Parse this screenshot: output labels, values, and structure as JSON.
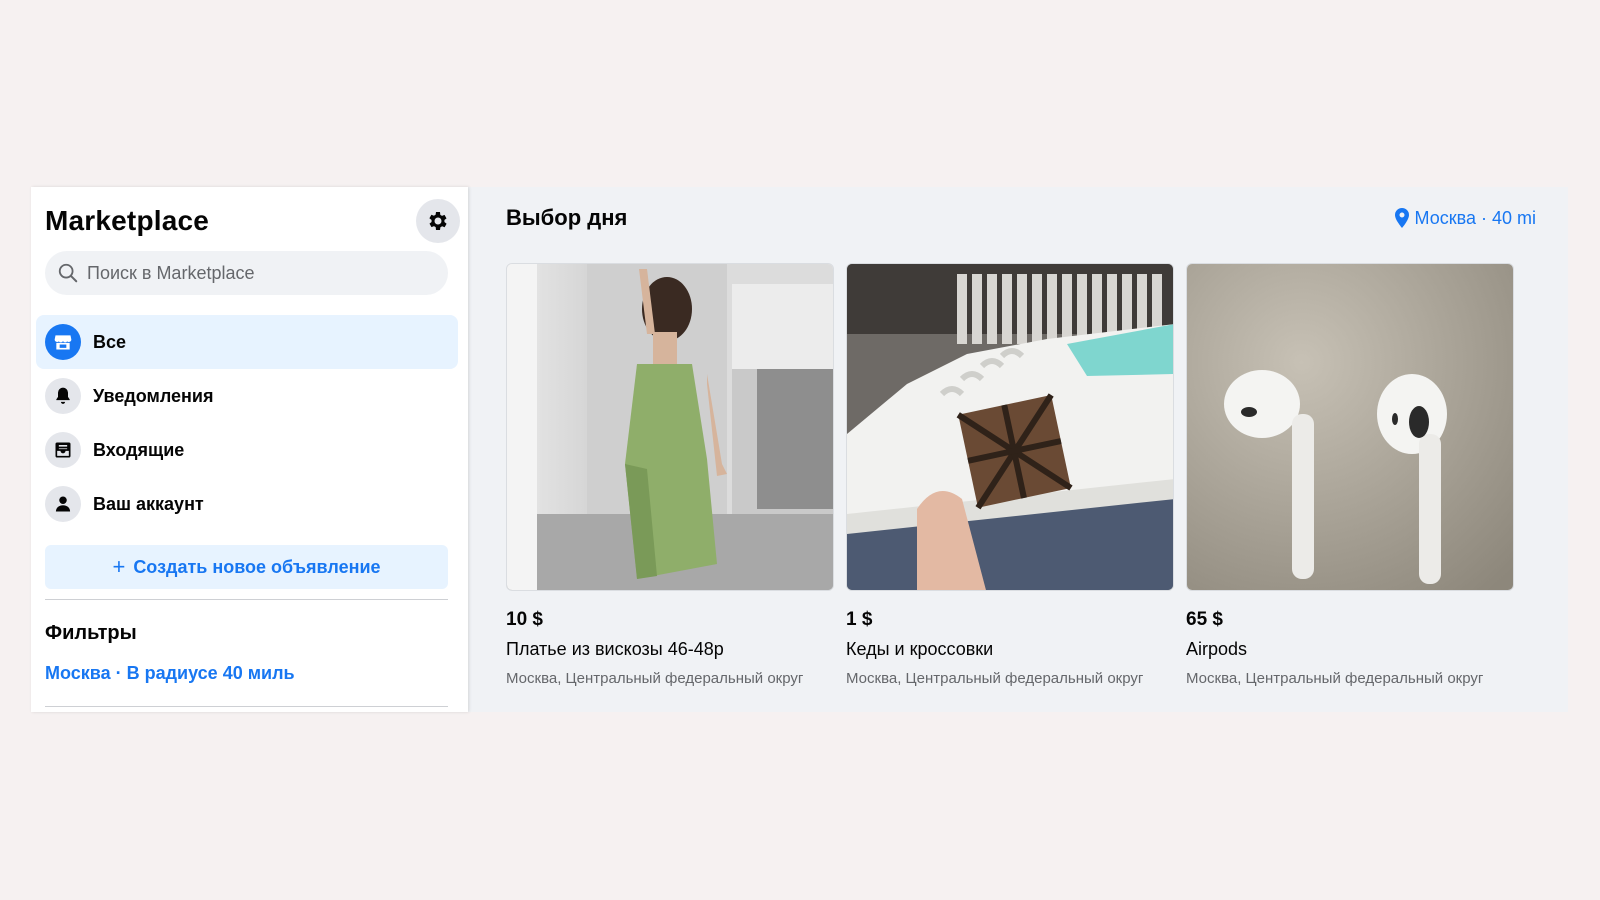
{
  "sidebar": {
    "title": "Marketplace",
    "search_placeholder": "Поиск в Marketplace",
    "items": [
      {
        "label": "Все",
        "icon": "storefront-icon",
        "active": true
      },
      {
        "label": "Уведомления",
        "icon": "bell-icon",
        "active": false
      },
      {
        "label": "Входящие",
        "icon": "inbox-icon",
        "active": false
      },
      {
        "label": "Ваш аккаунт",
        "icon": "person-icon",
        "active": false
      }
    ],
    "create_label": "Создать новое объявление",
    "filters_title": "Фильтры",
    "filters_location": "Москва · В радиусе 40 миль"
  },
  "main": {
    "title": "Выбор дня",
    "location": "Москва · 40 mi",
    "listings": [
      {
        "price": "10 $",
        "title": "Платье из вискозы 46-48р",
        "location": "Москва, Центральный федеральный округ",
        "image": "green-dress-photo"
      },
      {
        "price": "1 $",
        "title": "Кеды и кроссовки",
        "location": "Москва, Центральный федеральный округ",
        "image": "white-sneaker-photo"
      },
      {
        "price": "65 $",
        "title": "Airpods",
        "location": "Москва, Центральный федеральный округ",
        "image": "airpods-photo"
      }
    ]
  },
  "colors": {
    "accent": "#1877f2",
    "active_bg": "#e7f3ff",
    "page_bg": "#f6f1f1",
    "panel_bg": "#f0f2f5"
  }
}
